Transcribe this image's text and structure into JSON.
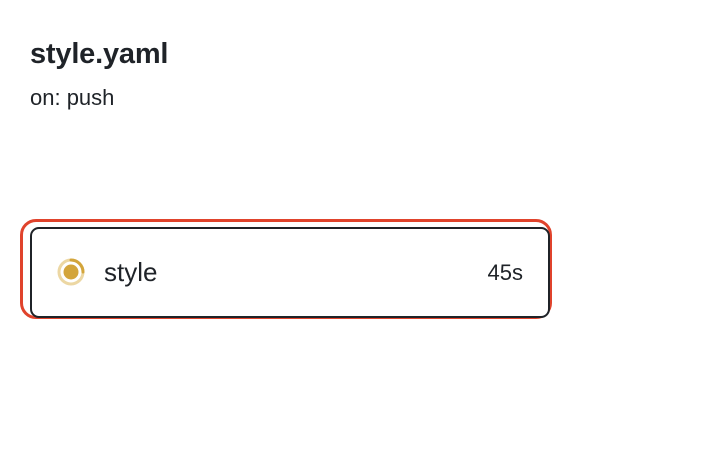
{
  "workflow": {
    "title": "style.yaml",
    "trigger": "on: push"
  },
  "job": {
    "name": "style",
    "duration": "45s",
    "status_icon": "in-progress-icon",
    "status_color": "#d3a53b"
  },
  "colors": {
    "highlight": "#e0432c",
    "card_border": "#1f2328",
    "text": "#1f2328"
  }
}
